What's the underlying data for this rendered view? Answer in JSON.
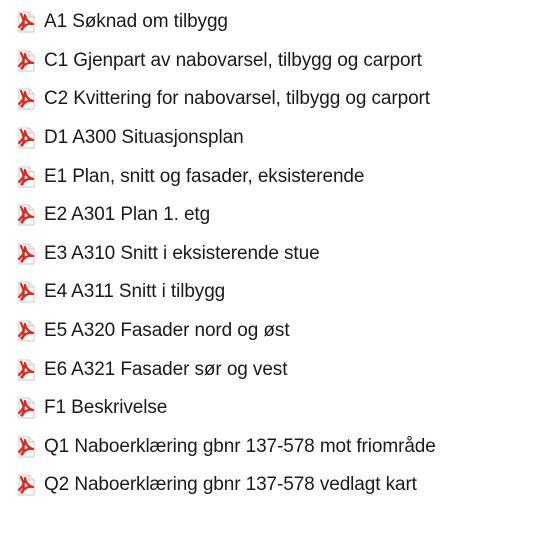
{
  "files": [
    {
      "icon": "pdf-icon",
      "name": "A1 Søknad om tilbygg"
    },
    {
      "icon": "pdf-icon",
      "name": "C1 Gjenpart av nabovarsel, tilbygg og carport"
    },
    {
      "icon": "pdf-icon",
      "name": "C2 Kvittering for nabovarsel, tilbygg og carport"
    },
    {
      "icon": "pdf-icon",
      "name": "D1 A300 Situasjonsplan"
    },
    {
      "icon": "pdf-icon",
      "name": "E1 Plan, snitt og fasader, eksisterende"
    },
    {
      "icon": "pdf-icon",
      "name": "E2 A301 Plan 1. etg"
    },
    {
      "icon": "pdf-icon",
      "name": "E3 A310 Snitt i eksisterende stue"
    },
    {
      "icon": "pdf-icon",
      "name": "E4 A311 Snitt i tilbygg"
    },
    {
      "icon": "pdf-icon",
      "name": "E5 A320 Fasader nord og øst"
    },
    {
      "icon": "pdf-icon",
      "name": "E6 A321 Fasader sør og vest"
    },
    {
      "icon": "pdf-icon",
      "name": "F1 Beskrivelse"
    },
    {
      "icon": "pdf-icon",
      "name": "Q1 Naboerklæring gbnr 137-578 mot friområde"
    },
    {
      "icon": "pdf-icon",
      "name": "Q2 Naboerklæring gbnr 137-578 vedlagt kart"
    }
  ],
  "colors": {
    "pdf_red": "#e1261c",
    "page_white": "#ffffff",
    "text": "#1a1a1a"
  }
}
